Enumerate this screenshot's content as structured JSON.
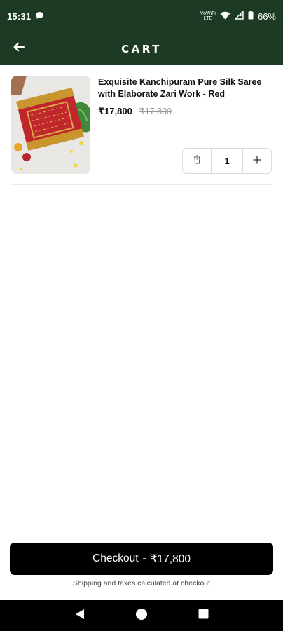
{
  "status_bar": {
    "time": "15:31",
    "network_label_top": "VoWiFi",
    "network_label_bottom": "LTE",
    "battery": "66%"
  },
  "app_bar": {
    "title": "CART",
    "back_icon": "arrow-left-icon"
  },
  "cart": {
    "items": [
      {
        "title": "Exquisite Kanchipuram Pure Silk Saree with Elaborate Zari Work - Red",
        "price": "₹17,800",
        "compare_price": "₹17,800",
        "quantity": "1",
        "delete_icon": "trash-icon",
        "increment_icon": "plus-icon"
      }
    ]
  },
  "checkout": {
    "label": "Checkout",
    "separator": "-",
    "total": "₹17,800",
    "note": "Shipping and taxes calculated at checkout"
  },
  "colors": {
    "header_bg": "#1d3b24",
    "checkout_bg": "#000000",
    "saree_red": "#c0272d",
    "zari_gold": "#d4a93a"
  }
}
